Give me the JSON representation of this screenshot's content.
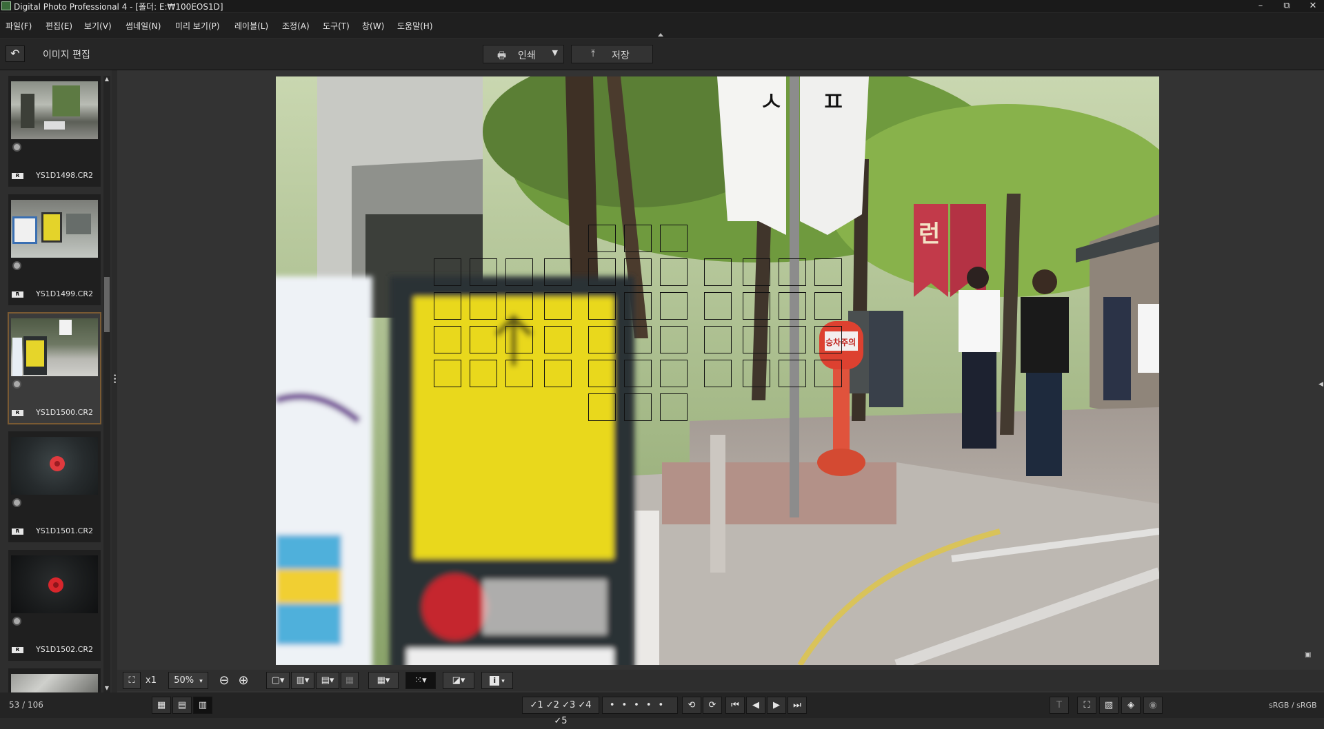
{
  "window": {
    "title": "Digital Photo Professional 4 - [폴더: E:₩100EOS1D]",
    "minimize": "–",
    "maximize": "⧉",
    "close": "✕"
  },
  "menu": [
    "파일(F)",
    "편집(E)",
    "보기(V)",
    "썸네일(N)",
    "미리 보기(P)",
    "레이블(L)",
    "조정(A)",
    "도구(T)",
    "창(W)",
    "도움말(H)"
  ],
  "toolbar": {
    "back_icon": "↶",
    "title": "이미지 편집",
    "print_label": "인쇄",
    "print_dropdown": "▼",
    "save_label": "저장"
  },
  "thumbnails": [
    {
      "filename": "YS1D1498.CR2",
      "raw_badge": "R"
    },
    {
      "filename": "YS1D1499.CR2",
      "raw_badge": "R"
    },
    {
      "filename": "YS1D1500.CR2",
      "raw_badge": "R",
      "selected": true
    },
    {
      "filename": "YS1D1501.CR2",
      "raw_badge": "R"
    },
    {
      "filename": "YS1D1502.CR2",
      "raw_badge": "R"
    }
  ],
  "photo_signs": {
    "pole_sign_text": "승차주의",
    "red_banner_text": "런"
  },
  "viewer_controls": {
    "fit": "⛶",
    "x1": "x1",
    "zoom": "50%",
    "zoom_dropdown": "▾",
    "zoom_out": "⊖",
    "zoom_in": "⊕",
    "info": "i"
  },
  "status": {
    "counter": "53 / 106",
    "color_space": "sRGB / sRGB",
    "rating_labels": [
      "✓1",
      "✓2",
      "✓3",
      "✓4",
      "✓5"
    ],
    "dots": [
      "•",
      "•",
      "•",
      "•",
      "•"
    ],
    "nav": [
      "⏮",
      "◀",
      "▶",
      "⏭"
    ]
  },
  "colors": {
    "selection_border": "#7a5a33",
    "sign_yellow": "#e9d81f",
    "banner_red": "#c23a4a"
  }
}
